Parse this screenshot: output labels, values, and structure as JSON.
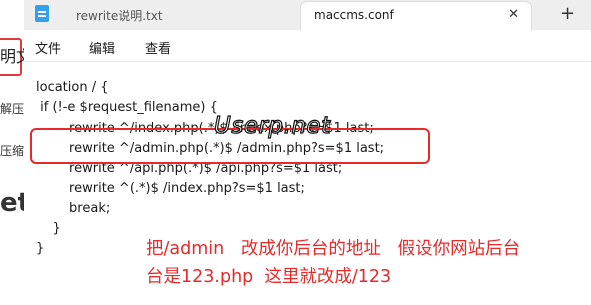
{
  "background_window": {
    "texts": [
      "明文",
      "解压",
      "压缩",
      "et"
    ]
  },
  "tabs": [
    {
      "label": "rewrite说明.txt",
      "active": false
    },
    {
      "label": "maccms.conf",
      "active": true
    }
  ],
  "tab_close_glyph": "✕",
  "new_tab_glyph": "+",
  "menu": {
    "file": "文件",
    "edit": "编辑",
    "view": "查看"
  },
  "editor": {
    "lines": [
      "location / {",
      " if (!-e $request_filename) {",
      "        rewrite ^/index.php(.*)$ /index.php?s=$1 last;",
      "        rewrite ^/admin.php(.*)$ /admin.php?s=$1 last;",
      "        rewrite ^/api.php(.*)$ /api.php?s=$1 last;",
      "        rewrite ^(.*)$ /index.php?s=$1 last;",
      "        break;",
      "    }",
      "}"
    ]
  },
  "watermark": "Userp.net",
  "annotation": {
    "line1": "把/admin   改成你后台的地址   假设你网站后台",
    "line2": "台是123.php  这里就改成/123"
  },
  "colors": {
    "annotation_red": "#e52a2a",
    "notepad_icon_blue": "#33a0ea"
  }
}
